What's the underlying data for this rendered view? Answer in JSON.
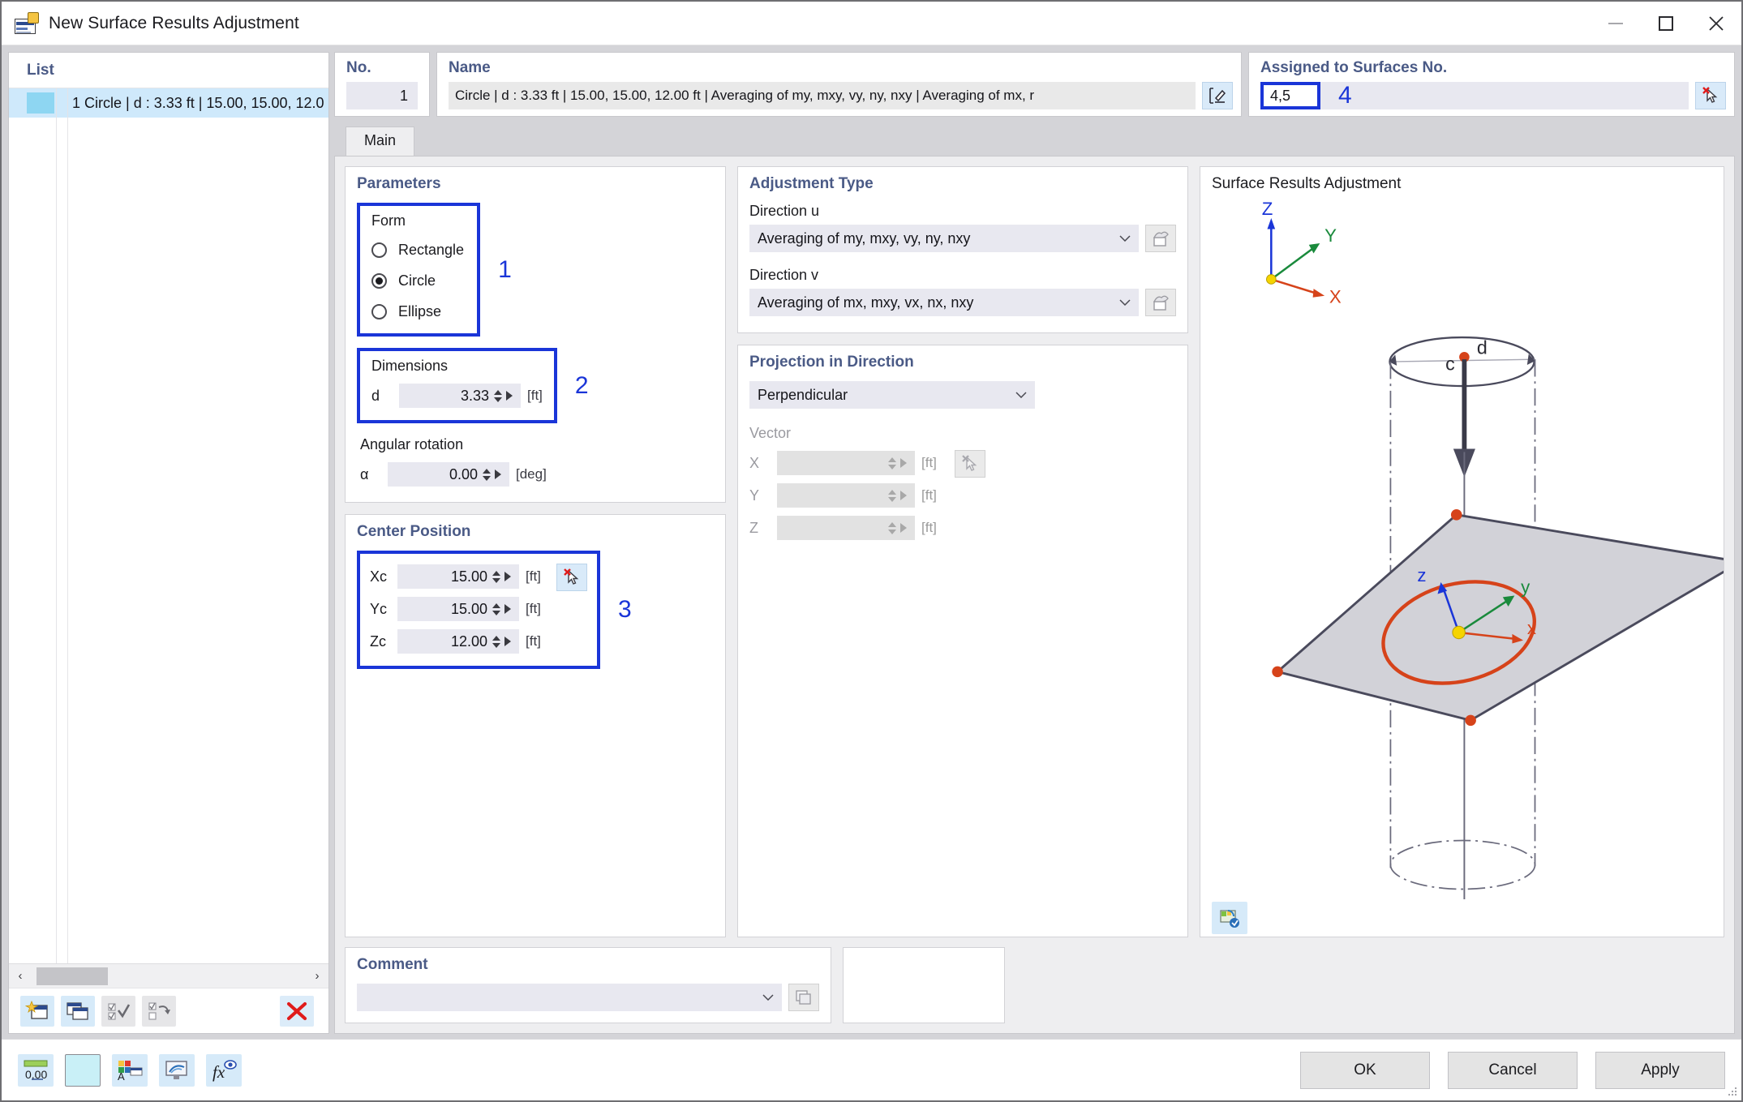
{
  "window": {
    "title": "New Surface Results Adjustment",
    "icon": "surface-results-icon",
    "minimize": "minimize-icon",
    "maximize": "maximize-icon",
    "close": "close-icon"
  },
  "list": {
    "header": "List",
    "rows": [
      {
        "label": "1 Circle | d : 3.33 ft | 15.00, 15.00, 12.0"
      }
    ],
    "toolbar": [
      {
        "name": "new-item-button",
        "title": "New"
      },
      {
        "name": "copy-item-button",
        "title": "Copy"
      },
      {
        "name": "select-all-button",
        "title": "Select All"
      },
      {
        "name": "invert-selection-button",
        "title": "Invert Selection"
      },
      {
        "name": "delete-item-button",
        "title": "Delete"
      }
    ],
    "scroll_left": "‹",
    "scroll_right": "›"
  },
  "header": {
    "no_label": "No.",
    "no_value": "1",
    "name_label": "Name",
    "name_value": "Circle | d : 3.33 ft | 15.00, 15.00, 12.00 ft | Averaging of my, mxy, vy, ny, nxy | Averaging of mx, r",
    "name_edit_icon": "edit-name-icon",
    "assigned_label": "Assigned to Surfaces No.",
    "assigned_value": "4,5",
    "assigned_pick_icon": "pick-surfaces-icon",
    "callout_4": "4"
  },
  "tabs": [
    {
      "label": "Main",
      "active": true
    }
  ],
  "parameters": {
    "title": "Parameters",
    "form": {
      "label": "Form",
      "options": [
        {
          "label": "Rectangle",
          "selected": false
        },
        {
          "label": "Circle",
          "selected": true
        },
        {
          "label": "Ellipse",
          "selected": false
        }
      ],
      "callout": "1"
    },
    "dimensions": {
      "label": "Dimensions",
      "key": "d",
      "value": "3.33",
      "unit": "[ft]",
      "callout": "2"
    },
    "angular_rotation": {
      "label": "Angular rotation",
      "key": "α",
      "value": "0.00",
      "unit": "[deg]"
    }
  },
  "center_position": {
    "title": "Center Position",
    "callout": "3",
    "pick_icon": "pick-point-icon",
    "rows": [
      {
        "key": "Xc",
        "value": "15.00",
        "unit": "[ft]"
      },
      {
        "key": "Yc",
        "value": "15.00",
        "unit": "[ft]"
      },
      {
        "key": "Zc",
        "value": "12.00",
        "unit": "[ft]"
      }
    ]
  },
  "adjustment_type": {
    "title": "Adjustment Type",
    "direction_u": {
      "label": "Direction u",
      "value": "Averaging of my, mxy, vy, ny, nxy",
      "icon": "adjustment-settings-icon"
    },
    "direction_v": {
      "label": "Direction v",
      "value": "Averaging of mx, mxy, vx, nx, nxy",
      "icon": "adjustment-settings-icon"
    }
  },
  "projection": {
    "title": "Projection in Direction",
    "mode": "Perpendicular",
    "vector_label": "Vector",
    "pick_icon": "pick-vector-icon",
    "rows": [
      {
        "key": "X",
        "value": "",
        "unit": "[ft]"
      },
      {
        "key": "Y",
        "value": "",
        "unit": "[ft]"
      },
      {
        "key": "Z",
        "value": "",
        "unit": "[ft]"
      }
    ]
  },
  "comment": {
    "title": "Comment",
    "value": "",
    "icon": "comment-library-icon"
  },
  "preview": {
    "title": "Surface Results Adjustment",
    "global_axes": {
      "x": "X",
      "y": "Y",
      "z": "Z"
    },
    "local_axes": {
      "x": "x",
      "y": "y",
      "z": "z"
    },
    "labels": {
      "diameter": "d",
      "center": "c"
    },
    "settings_icon": "preview-settings-icon"
  },
  "footer": {
    "icons": [
      {
        "name": "units-icon",
        "label": "0,00"
      },
      {
        "name": "color-swatch-icon",
        "label": ""
      },
      {
        "name": "display-properties-icon",
        "label": ""
      },
      {
        "name": "visualization-icon",
        "label": ""
      },
      {
        "name": "formula-icon",
        "label": "fx"
      }
    ],
    "buttons": [
      {
        "label": "OK",
        "name": "ok-button"
      },
      {
        "label": "Cancel",
        "name": "cancel-button"
      },
      {
        "label": "Apply",
        "name": "apply-button"
      }
    ]
  },
  "colors": {
    "accent_blue": "#1a35d8",
    "panel_heading": "#4a5a86",
    "selection": "#cfe9fb",
    "field_bg": "#e8e8f0",
    "axis_x": "#d6431a",
    "axis_y": "#1a8a3c",
    "axis_z": "#1a35d8",
    "surface_fill": "#d2d2d8",
    "circle_stroke": "#d6431a",
    "support_green": "#2f9e4a"
  }
}
